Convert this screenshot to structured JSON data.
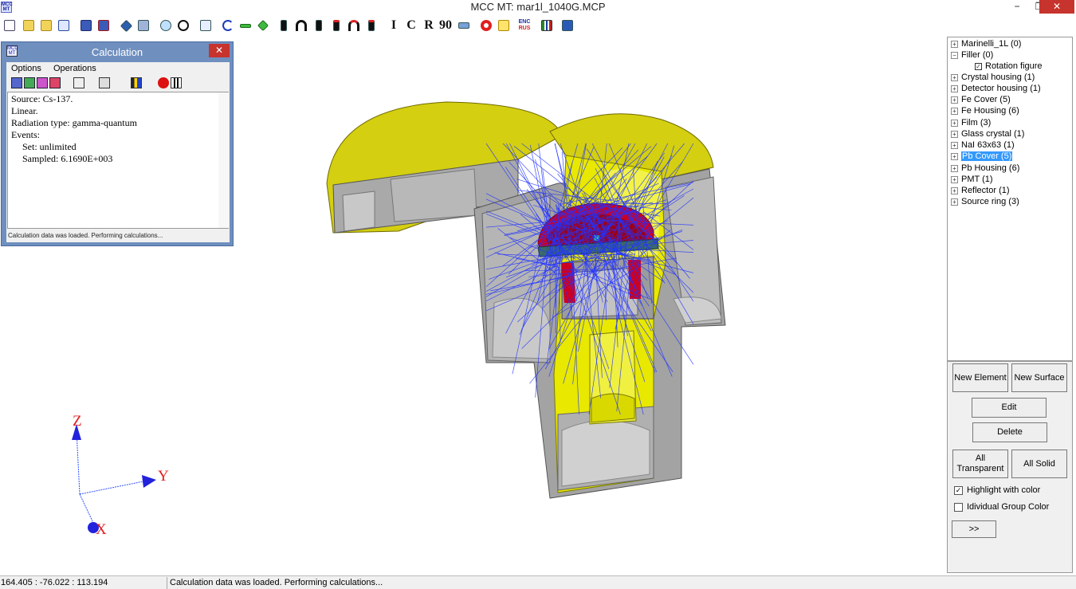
{
  "window": {
    "title": "MCC MT: mar1l_1040G.MCP",
    "minimize_label": "−",
    "maximize_label": "❐",
    "close_label": "✕"
  },
  "toolbar": {
    "text_buttons": [
      "I",
      "C",
      "R",
      "90"
    ],
    "enc_label": "ENC",
    "rus_label": "RUS"
  },
  "calc_window": {
    "title": "Calculation",
    "close_label": "✕",
    "menu": [
      "Options",
      "Operations"
    ],
    "lines": {
      "source": "Source: Cs-137.",
      "linear": "Linear.",
      "radiation": "Radiation type: gamma-quantum",
      "events": "Events:",
      "set": "Set: unlimited",
      "sampled": "Sampled: 6.1690E+003"
    },
    "status": "Calculation data was loaded. Performing calculations..."
  },
  "axes": {
    "z": "Z",
    "y": "Y",
    "x": "X"
  },
  "tree": {
    "items": [
      {
        "label": "Marinelli_1L (0)",
        "sign": "+"
      },
      {
        "label": "Filler (0)",
        "sign": "−"
      },
      {
        "label": "Rotation figure",
        "checked_mark": "✓"
      },
      {
        "label": "Crystal housing (1)",
        "sign": "+"
      },
      {
        "label": "Detector housing  (1)",
        "sign": "+"
      },
      {
        "label": "Fe Cover (5)",
        "sign": "+"
      },
      {
        "label": "Fe Housing (6)",
        "sign": "+"
      },
      {
        "label": "Film (3)",
        "sign": "+"
      },
      {
        "label": "Glass crystal (1)",
        "sign": "+"
      },
      {
        "label": "NaI 63x63 (1)",
        "sign": "+"
      },
      {
        "label": "Pb Cover (5)",
        "sign": "+"
      },
      {
        "label": "Pb Housing (6)",
        "sign": "+"
      },
      {
        "label": "PMT (1)",
        "sign": "+"
      },
      {
        "label": "Reflector (1)",
        "sign": "+"
      },
      {
        "label": "Source ring (3)",
        "sign": "+"
      }
    ]
  },
  "panel": {
    "new_element": "New Element",
    "new_surface": "New Surface",
    "edit": "Edit",
    "delete": "Delete",
    "all_transparent_1": "All",
    "all_transparent_2": "Transparent",
    "all_solid": "All Solid",
    "highlight": "Highlight with color",
    "highlight_mark": "✓",
    "individual": "Idividual Group Color",
    "more": ">>"
  },
  "statusbar": {
    "coords": "164.405 : -76.022 : 113.194",
    "message": "Calculation data was loaded. Performing calculations..."
  },
  "colors": {
    "accent": "#3399ff",
    "model_yellow": "#e6e600",
    "model_gray": "#a8a8a8",
    "tracks": "#2233ff",
    "detector": "#cc0022"
  }
}
